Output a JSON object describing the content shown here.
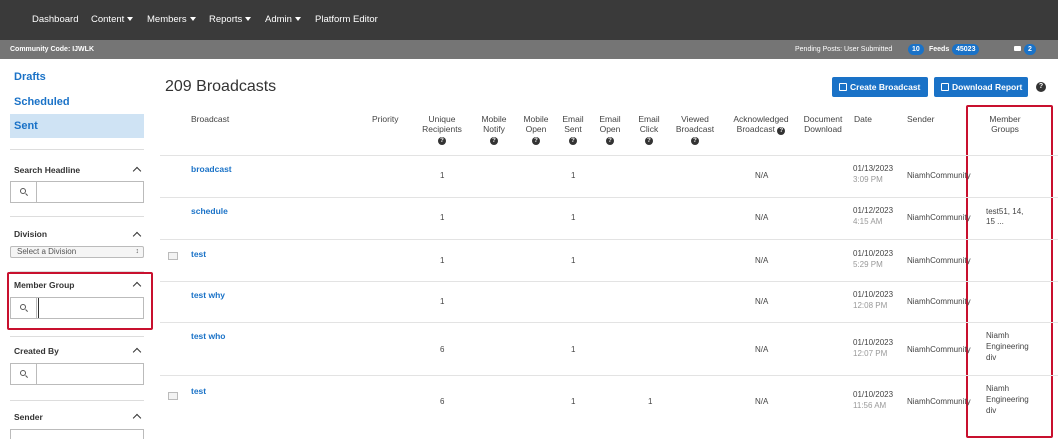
{
  "topnav": {
    "items": [
      {
        "label": "Dashboard",
        "dropdown": false
      },
      {
        "label": "Content",
        "dropdown": true
      },
      {
        "label": "Members",
        "dropdown": true
      },
      {
        "label": "Reports",
        "dropdown": true
      },
      {
        "label": "Admin",
        "dropdown": true
      },
      {
        "label": "Platform Editor",
        "dropdown": false
      }
    ]
  },
  "subbar": {
    "community_code": "Community Code: IJWLK",
    "pending_label": "Pending Posts:",
    "user_submitted_label": "User Submitted",
    "user_submitted_count": "10",
    "feeds_label": "Feeds",
    "feeds_count": "45023",
    "mail_count": "2"
  },
  "sidebar": {
    "links": [
      "Drafts",
      "Scheduled",
      "Sent"
    ],
    "active": "Sent",
    "filters": {
      "search_headline": "Search Headline",
      "division": "Division",
      "division_placeholder": "Select a Division",
      "member_group": "Member Group",
      "created_by": "Created By",
      "sender": "Sender"
    }
  },
  "main": {
    "title": "209 Broadcasts",
    "create_button": "Create Broadcast",
    "download_button": "Download Report",
    "help": "?"
  },
  "table": {
    "headers": {
      "broadcast": "Broadcast",
      "priority": "Priority",
      "unique_recipients": [
        "Unique",
        "Recipients"
      ],
      "mobile_notify": [
        "Mobile",
        "Notify"
      ],
      "mobile_open": [
        "Mobile",
        "Open"
      ],
      "email_sent": [
        "Email",
        "Sent"
      ],
      "email_open": [
        "Email",
        "Open"
      ],
      "email_click": [
        "Email",
        "Click"
      ],
      "viewed_broadcast": [
        "Viewed",
        "Broadcast"
      ],
      "acknowledged_broadcast": [
        "Acknowledged",
        "Broadcast"
      ],
      "document_download": [
        "Document",
        "Download"
      ],
      "date": "Date",
      "sender": "Sender",
      "member_groups": [
        "Member",
        "Groups"
      ]
    },
    "rows": [
      {
        "title": "broadcast",
        "unique_recipients": "1",
        "email_sent": "1",
        "email_click": "",
        "acknowledged": "N/A",
        "date": "01/13/2023",
        "time": "3:09 PM",
        "sender": "NiamhCommunity",
        "member_groups": [],
        "has_doc": false
      },
      {
        "title": "schedule",
        "unique_recipients": "1",
        "email_sent": "1",
        "email_click": "",
        "acknowledged": "N/A",
        "date": "01/12/2023",
        "time": "4:15 AM",
        "sender": "NiamhCommunity",
        "member_groups": [
          "test51, 14,",
          "15 ..."
        ],
        "has_doc": false
      },
      {
        "title": "test",
        "unique_recipients": "1",
        "email_sent": "1",
        "email_click": "",
        "acknowledged": "N/A",
        "date": "01/10/2023",
        "time": "5:29 PM",
        "sender": "NiamhCommunity",
        "member_groups": [],
        "has_doc": true
      },
      {
        "title": "test why",
        "unique_recipients": "1",
        "email_sent": "",
        "email_click": "",
        "acknowledged": "N/A",
        "date": "01/10/2023",
        "time": "12:08 PM",
        "sender": "NiamhCommunity",
        "member_groups": [],
        "has_doc": false
      },
      {
        "title": "test who",
        "unique_recipients": "6",
        "email_sent": "1",
        "email_click": "",
        "acknowledged": "N/A",
        "date": "01/10/2023",
        "time": "12:07 PM",
        "sender": "NiamhCommunity",
        "member_groups": [
          "Niamh",
          "Engineering",
          "div"
        ],
        "has_doc": false
      },
      {
        "title": "test",
        "unique_recipients": "6",
        "email_sent": "1",
        "email_click": "1",
        "acknowledged": "N/A",
        "date": "01/10/2023",
        "time": "11:56 AM",
        "sender": "NiamhCommunity",
        "member_groups": [
          "Niamh",
          "Engineering",
          "div"
        ],
        "has_doc": true
      }
    ]
  },
  "colors": {
    "accent": "#1a72c7",
    "highlight": "#c8102e",
    "nav": "#3a3a3a"
  }
}
